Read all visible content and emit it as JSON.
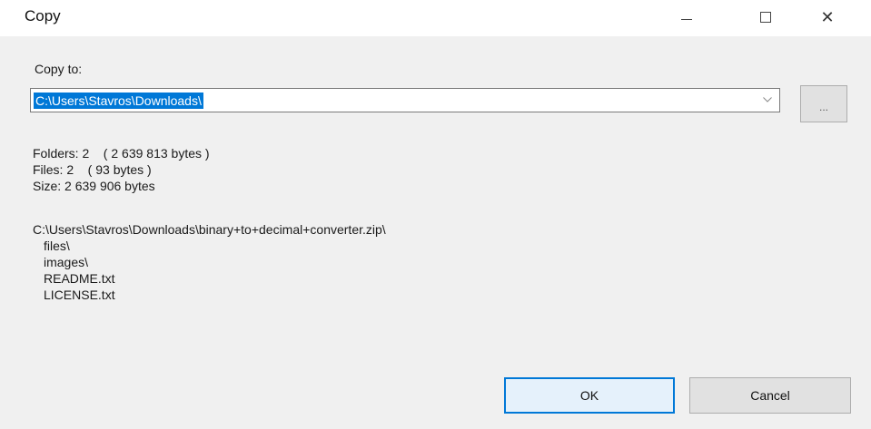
{
  "window": {
    "title": "Copy"
  },
  "title_buttons": {
    "minimize_icon": "minimize-icon",
    "maximize_icon": "maximize-icon",
    "close_glyph": "✕"
  },
  "destination": {
    "label": "Copy to:",
    "value": "C:\\Users\\Stavros\\Downloads\\",
    "selection_color": "#0078d7"
  },
  "browse_button": {
    "label": "..."
  },
  "summary": {
    "folders": "Folders: 2    ( 2 639 813 bytes )",
    "files": "Files: 2    ( 93 bytes )",
    "size": "Size: 2 639 906 bytes"
  },
  "tree": {
    "root": "C:\\Users\\Stavros\\Downloads\\binary+to+decimal+converter.zip\\",
    "items": [
      "files\\",
      "images\\",
      "README.txt",
      "LICENSE.txt"
    ]
  },
  "buttons": {
    "ok": "OK",
    "cancel": "Cancel",
    "accent": "#0078d7"
  }
}
